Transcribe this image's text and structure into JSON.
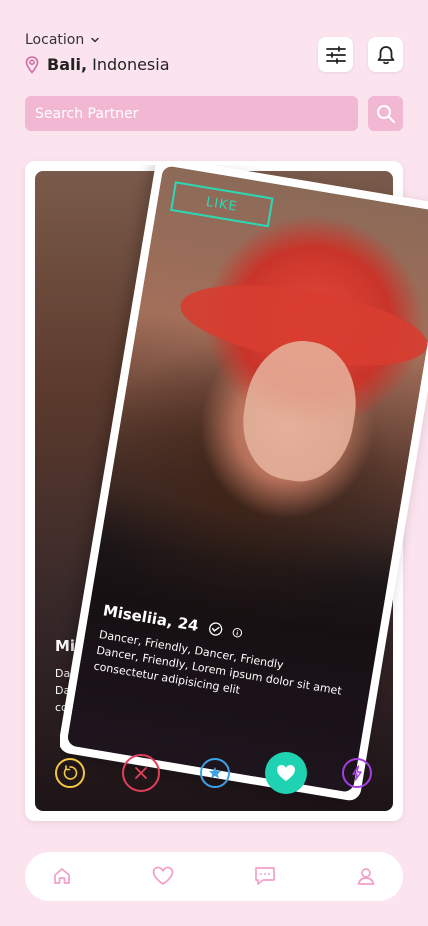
{
  "header": {
    "location_label": "Location",
    "location_city": "Bali,",
    "location_country": "Indonesia"
  },
  "search": {
    "placeholder": "Search Partner"
  },
  "back_card": {
    "name": "Mis",
    "desc_lines": [
      "Da",
      "Da",
      "co"
    ]
  },
  "front_card": {
    "stamp": "LIKE",
    "name": "Miseliia, 24",
    "desc_lines": [
      "Dancer, Friendly, Dancer, Friendly",
      "Dancer, Friendly,  Lorem ipsum dolor sit amet",
      "consectetur adipisicing elit"
    ]
  },
  "actions": [
    {
      "icon": "rewind-icon",
      "color": "#f3c744"
    },
    {
      "icon": "close-icon",
      "color": "#e1405b"
    },
    {
      "icon": "star-icon",
      "color": "#3ea3e6"
    },
    {
      "icon": "heart-icon",
      "color": "#1fd3b2"
    },
    {
      "icon": "bolt-icon",
      "color": "#a53fe0"
    }
  ],
  "colors": {
    "background": "#fce4ef",
    "accent_pink": "#f2b7d3",
    "like_teal": "#2bd9b6"
  },
  "nav": [
    "home-icon",
    "heart-icon",
    "chat-icon",
    "profile-icon"
  ]
}
